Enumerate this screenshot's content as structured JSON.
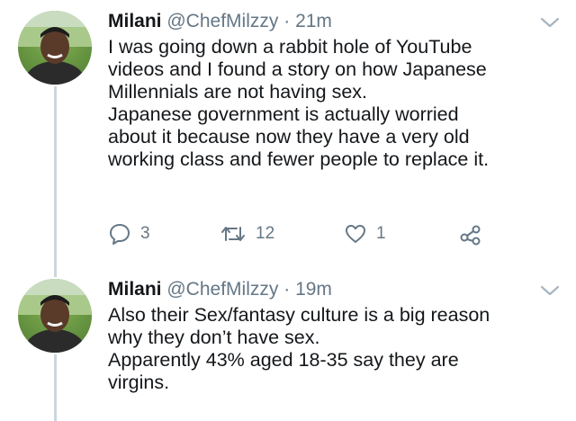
{
  "tweets": [
    {
      "name": "Milani",
      "handle": "@ChefMilzzy",
      "separator": "·",
      "time": "21m",
      "lines": [
        "I was going down a rabbit hole of YouTube",
        "videos and I found a story on how Japanese",
        "Millennials are not having sex.",
        "Japanese government is actually worried",
        "about it because now they have a very old",
        "working class and fewer people to replace it."
      ],
      "replies": "3",
      "retweets": "12",
      "likes": "1",
      "icons": {
        "reply": "reply-icon",
        "retweet": "retweet-icon",
        "like": "heart-icon",
        "share": "share-icon",
        "menu": "chevron-down-icon"
      }
    },
    {
      "name": "Milani",
      "handle": "@ChefMilzzy",
      "separator": "·",
      "time": "19m",
      "lines": [
        "Also their Sex/fantasy culture is a big reason",
        "why they don’t have sex.",
        "Apparently 43% aged 18-35 say they are",
        "virgins."
      ]
    }
  ],
  "colors": {
    "text": "#14171a",
    "secondary": "#657786",
    "thread_line": "#ccd6dd"
  }
}
